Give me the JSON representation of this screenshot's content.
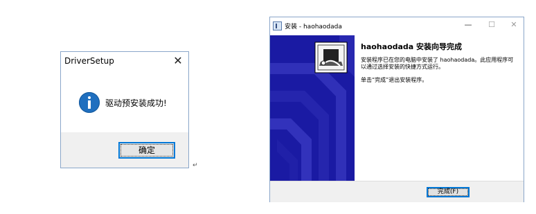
{
  "driver_dialog": {
    "title": "DriverSetup",
    "close_glyph": "✕",
    "icon": "info-icon",
    "message": "驱动预安装成功!",
    "ok_label": "确定"
  },
  "pilcrow": "↵",
  "wizard": {
    "title": "安装 - haohaodada",
    "controls": {
      "minimize": "—",
      "maximize": "☐",
      "close": "✕"
    },
    "heading": "haohaodada 安装向导完成",
    "paragraph1": "安装程序已在您的电脑中安装了 haohaodada。此应用程序可以通过选择安装的快捷方式运行。",
    "paragraph2": "单击“完成”退出安装程序。",
    "finish_label": "完成(F)",
    "colors": {
      "banner": "#1a1aa3",
      "accent": "#0078d7"
    }
  }
}
